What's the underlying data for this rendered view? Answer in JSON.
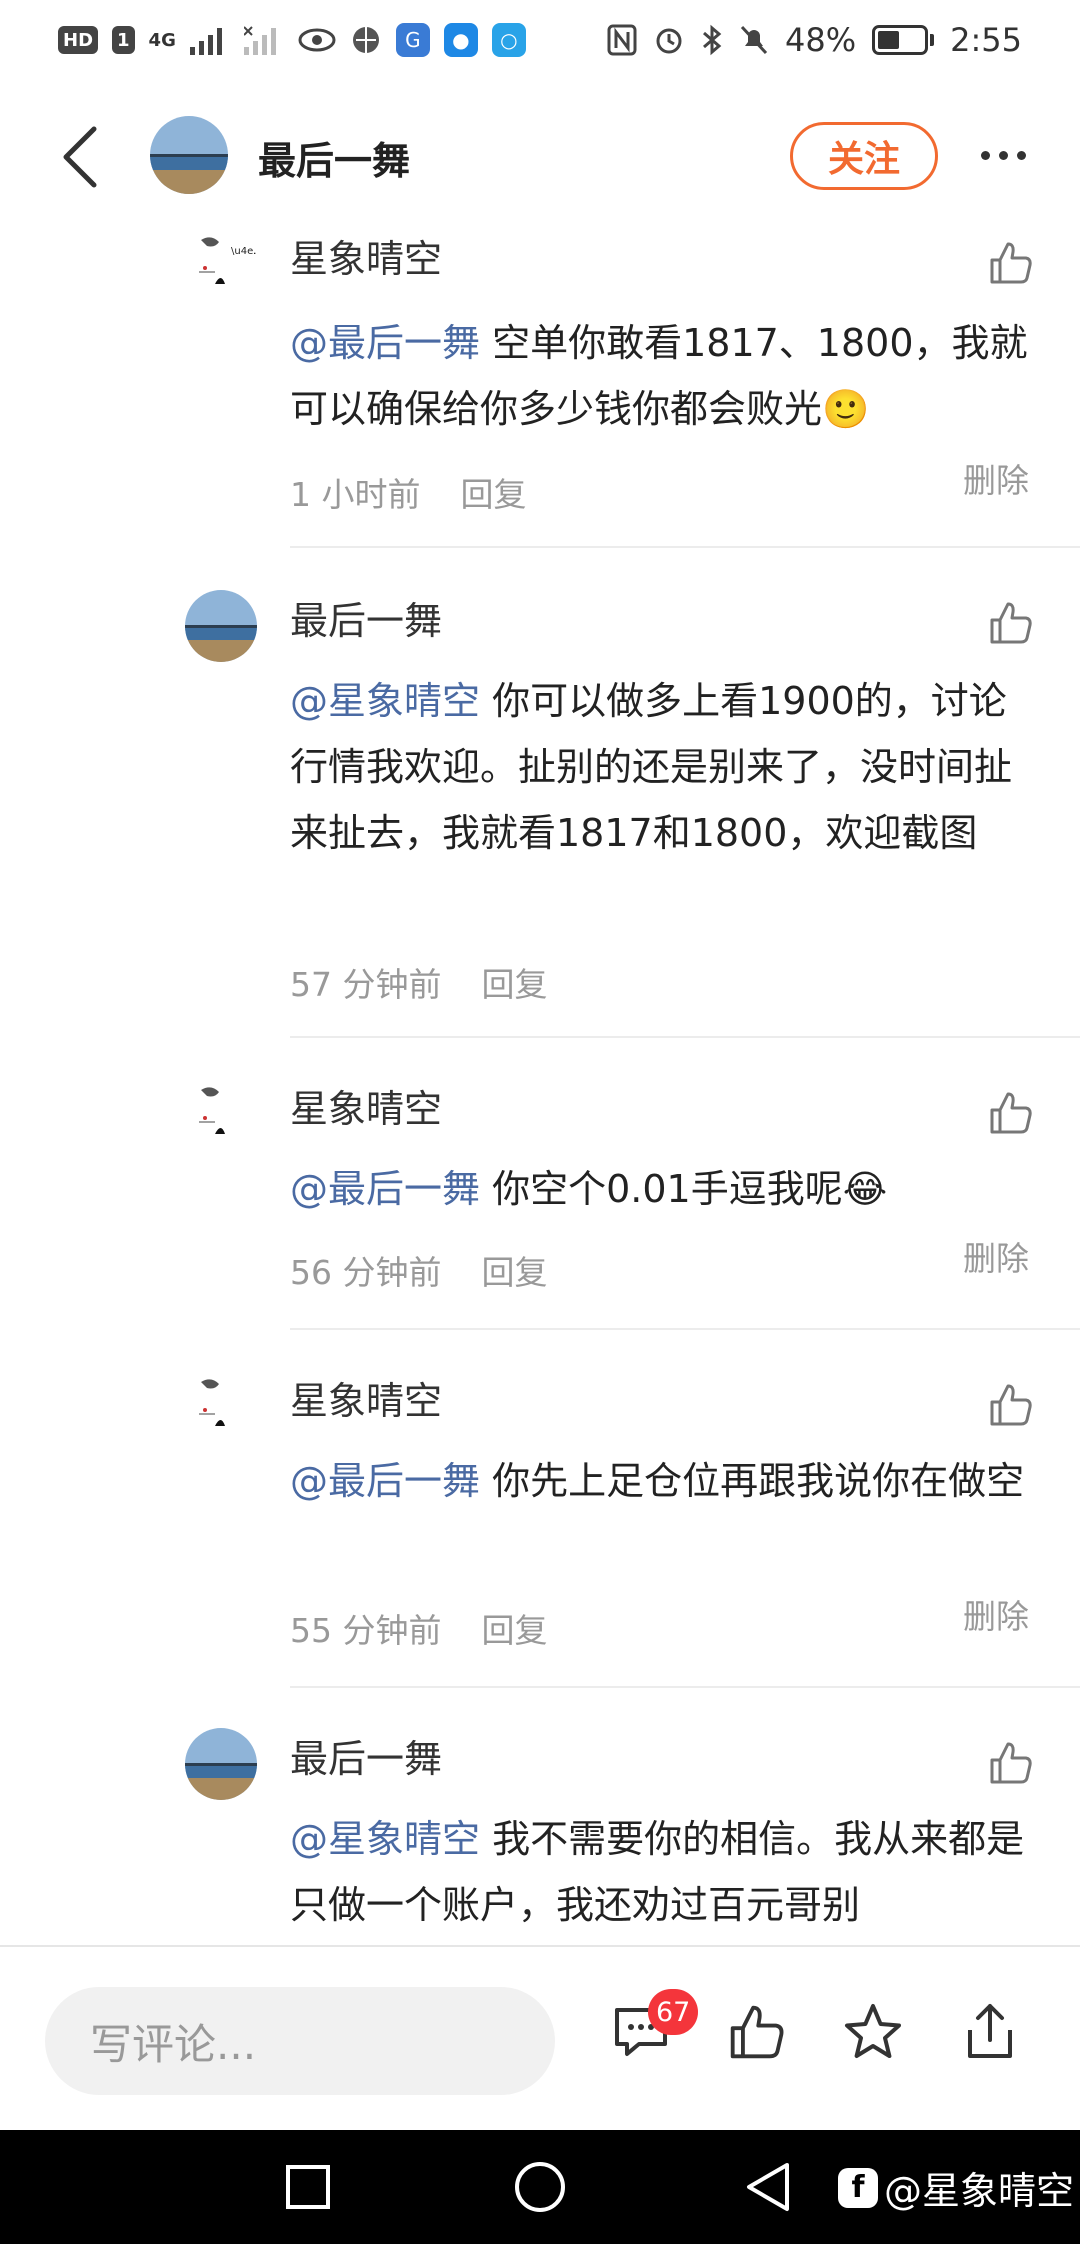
{
  "status_bar": {
    "left_badges": [
      "HD",
      "1"
    ],
    "network": "4G",
    "battery": "48%",
    "battery_level": 0.48,
    "time": "2:55"
  },
  "header": {
    "back_icon": "chevron-left-icon",
    "name": "最后一舞",
    "follow_label": "关注",
    "more_icon": "more-dots-icon"
  },
  "comments": [
    {
      "user": "星象晴空",
      "mention": "@最后一舞",
      "text": " 空单你敢看1817、1800，我就可以确保给你多少钱你都会败光🙂",
      "time": "1 小时前",
      "reply": "回复",
      "delete": "删除"
    },
    {
      "user": "最后一舞",
      "mention": "@星象晴空",
      "text": " 你可以做多上看1900的，讨论行情我欢迎。扯别的还是别来了，没时间扯来扯去，我就看1817和1800，欢迎截图",
      "time": "57 分钟前",
      "reply": "回复",
      "delete": ""
    },
    {
      "user": "星象晴空",
      "mention": "@最后一舞",
      "text": " 你空个0.01手逗我呢😂",
      "time": "56 分钟前",
      "reply": "回复",
      "delete": "删除"
    },
    {
      "user": "星象晴空",
      "mention": "@最后一舞",
      "text": " 你先上足仓位再跟我说你在做空",
      "time": "55 分钟前",
      "reply": "回复",
      "delete": "删除"
    },
    {
      "user": "最后一舞",
      "mention": "@星象晴空",
      "text": " 我不需要你的相信。我从来都是只做一个账户，我还劝过百元哥别",
      "time": "",
      "reply": "",
      "delete": ""
    }
  ],
  "bottom_bar": {
    "input_placeholder": "写评论...",
    "comment_count": "67",
    "icons": [
      "comment-icon",
      "thumbs-up-icon",
      "star-icon",
      "share-icon"
    ]
  },
  "nav_bar": {
    "watermark_logo": "f",
    "watermark_text": "@星象晴空"
  }
}
